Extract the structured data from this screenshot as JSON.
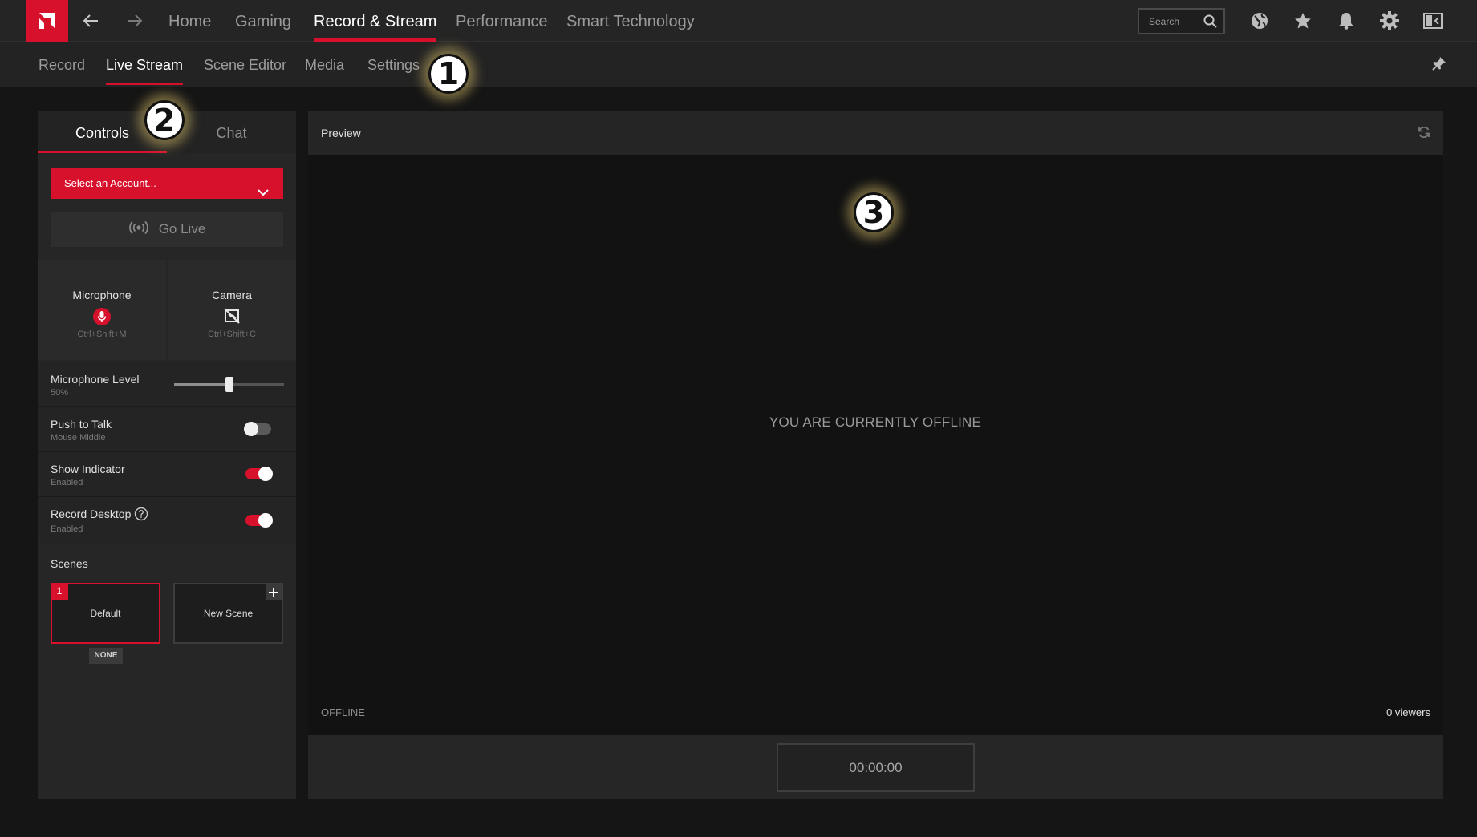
{
  "topnav": {
    "tabs": [
      {
        "label": "Home"
      },
      {
        "label": "Gaming"
      },
      {
        "label": "Record & Stream"
      },
      {
        "label": "Performance"
      },
      {
        "label": "Smart Technology"
      }
    ],
    "search_placeholder": "Search"
  },
  "subnav": {
    "tabs": [
      {
        "label": "Record"
      },
      {
        "label": "Live Stream"
      },
      {
        "label": "Scene Editor"
      },
      {
        "label": "Media"
      },
      {
        "label": "Settings"
      }
    ]
  },
  "callouts": [
    "1",
    "2",
    "3"
  ],
  "left_panel": {
    "tabs": [
      {
        "label": "Controls"
      },
      {
        "label": "Chat"
      }
    ],
    "account_select": "Select an Account...",
    "go_live": "Go Live",
    "microphone": {
      "label": "Microphone",
      "hotkey": "Ctrl+Shift+M"
    },
    "camera": {
      "label": "Camera",
      "hotkey": "Ctrl+Shift+C"
    },
    "mic_level": {
      "label": "Microphone Level",
      "value_text": "50%",
      "value": 0.5
    },
    "push_to_talk": {
      "label": "Push to Talk",
      "sub": "Mouse Middle",
      "on": false
    },
    "show_indicator": {
      "label": "Show Indicator",
      "sub": "Enabled",
      "on": true
    },
    "record_desktop": {
      "label": "Record Desktop",
      "sub": "Enabled",
      "on": true
    },
    "scenes": {
      "label": "Scenes",
      "items": [
        {
          "name": "Default",
          "number": "1",
          "badge": "NONE"
        },
        {
          "name": "New Scene"
        }
      ]
    }
  },
  "preview": {
    "title": "Preview",
    "message": "YOU ARE CURRENTLY OFFLINE",
    "status": "OFFLINE",
    "viewers": "0 viewers",
    "timer": "00:00:00"
  },
  "colors": {
    "accent": "#d7102c",
    "background": "#151515"
  }
}
